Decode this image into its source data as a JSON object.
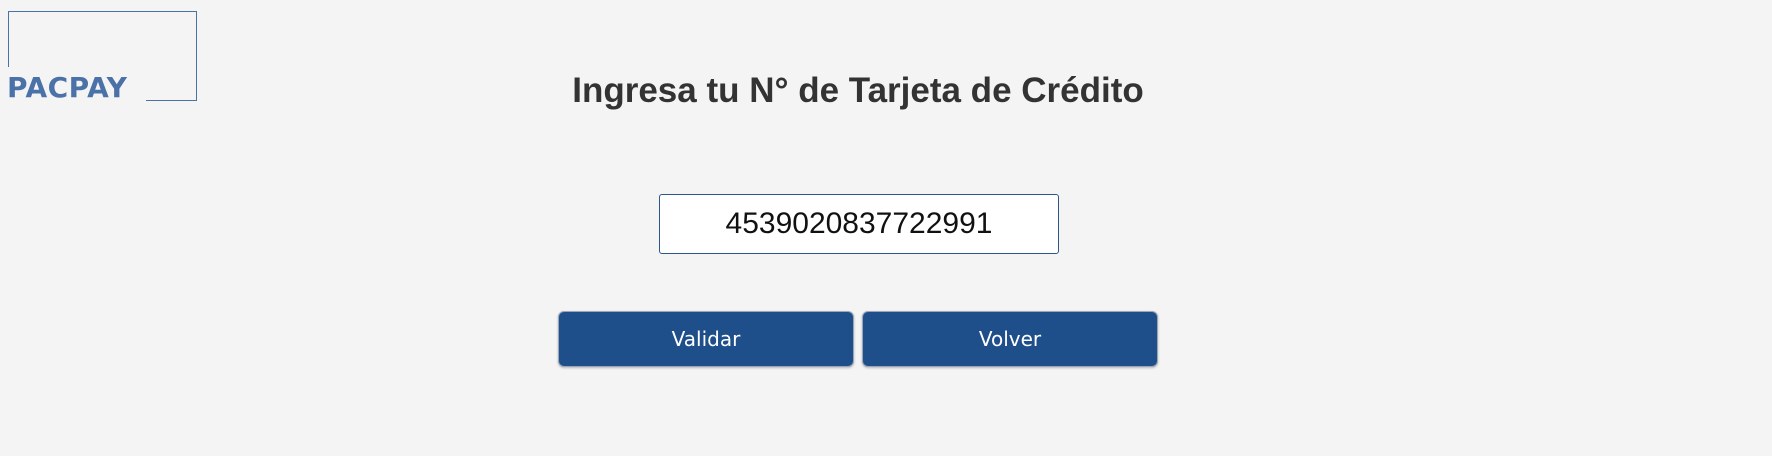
{
  "logo": {
    "text": "PACPAY"
  },
  "title": "Ingresa tu N° de Tarjeta de Crédito",
  "card_input": {
    "value": "4539020837722991",
    "placeholder": ""
  },
  "buttons": {
    "validar_label": "Validar",
    "volver_label": "Volver"
  },
  "colors": {
    "background": "#f4f4f4",
    "brand": "#4a72a8",
    "button": "#1f4f8a",
    "title": "#333333"
  }
}
